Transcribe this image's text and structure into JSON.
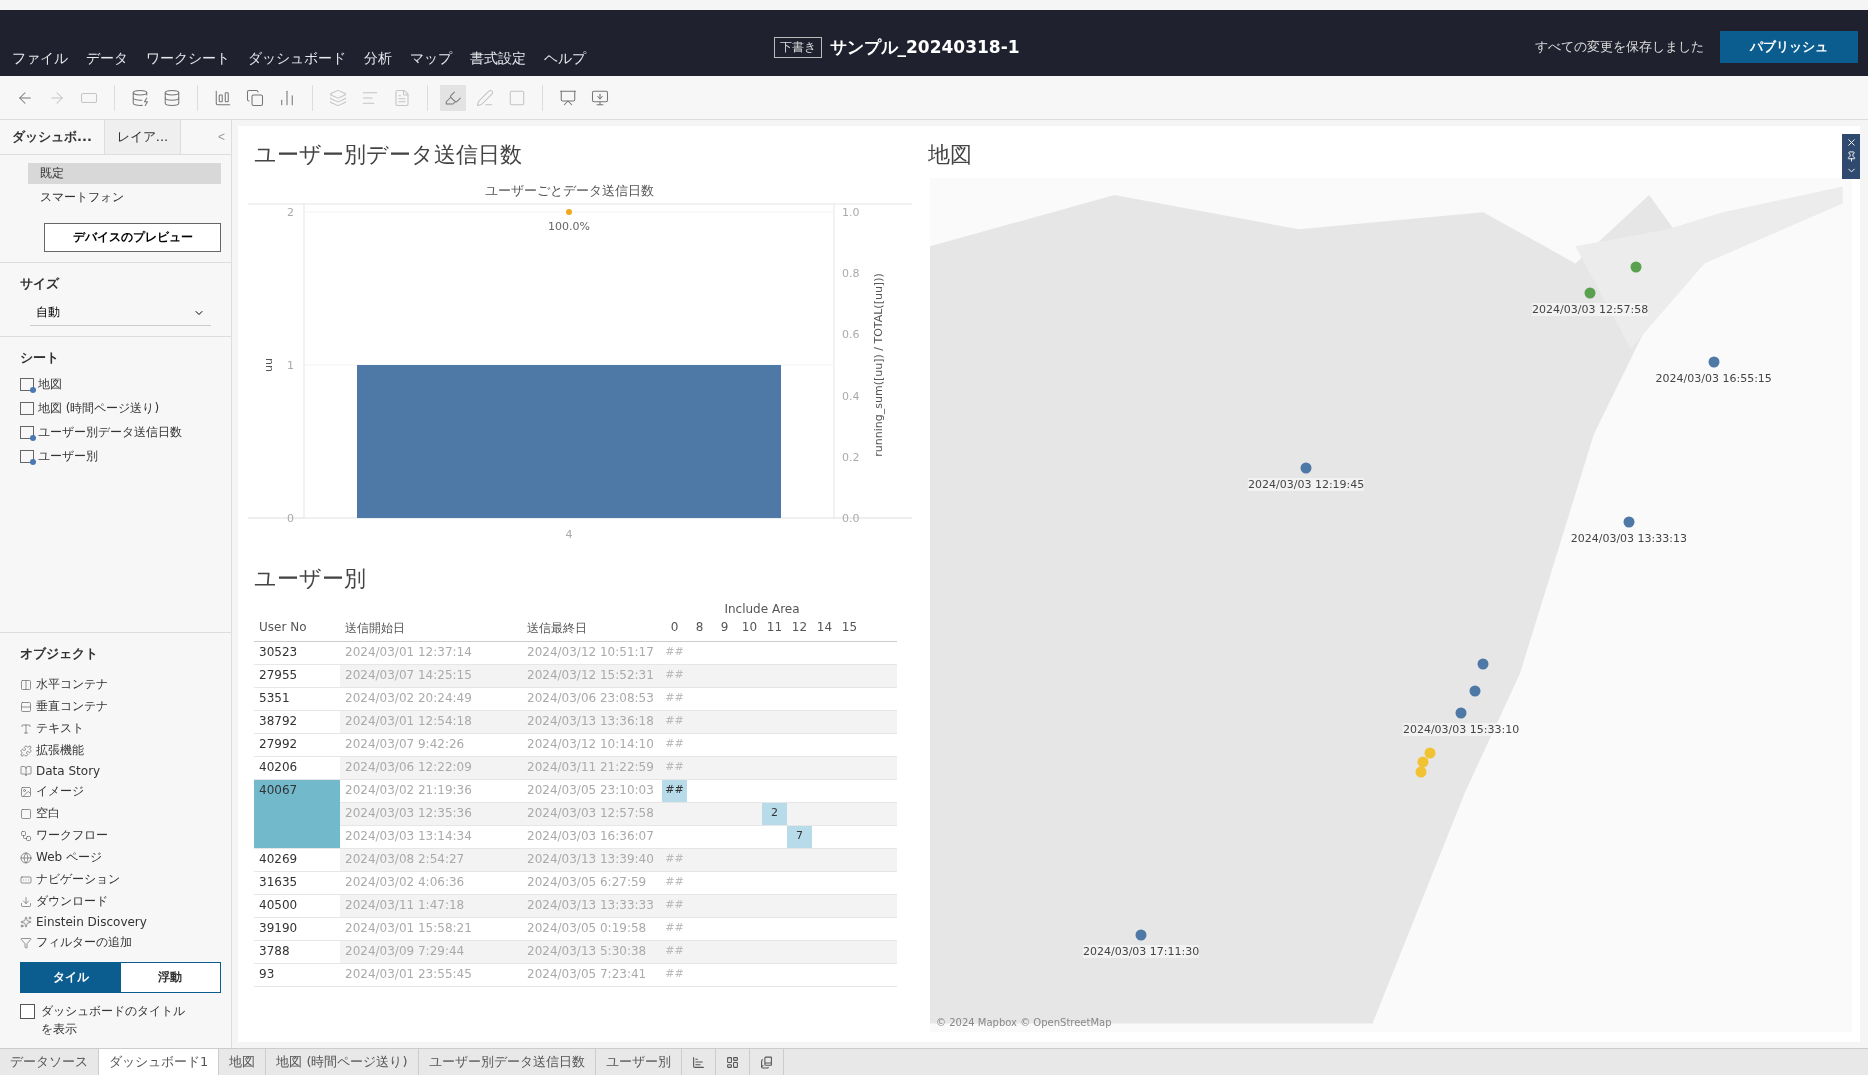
{
  "header": {
    "menus": [
      "ファイル",
      "データ",
      "ワークシート",
      "ダッシュボード",
      "分析",
      "マップ",
      "書式設定",
      "ヘルプ"
    ],
    "badge": "下書き",
    "title": "サンプル_20240318-1",
    "save_status": "すべての変更を保存しました",
    "publish": "パブリッシュ"
  },
  "sidebar": {
    "tabs": [
      {
        "label": "ダッシュボ...",
        "selected": true
      },
      {
        "label": "レイア...",
        "selected": false
      }
    ],
    "collapse": "<",
    "devices": [
      {
        "label": "既定",
        "selected": true
      },
      {
        "label": "スマートフォン",
        "selected": false
      }
    ],
    "preview_button": "デバイスのプレビュー",
    "size_heading": "サイズ",
    "size_value": "自動",
    "sheets_heading": "シート",
    "sheets": [
      "地図",
      "地図 (時間ページ送り)",
      "ユーザー別データ送信日数",
      "ユーザー別"
    ],
    "objects_heading": "オブジェクト",
    "objects": [
      "水平コンテナ",
      "垂直コンテナ",
      "テキスト",
      "拡張機能",
      "Data Story",
      "イメージ",
      "空白",
      "ワークフロー",
      "Web ページ",
      "ナビゲーション",
      "ダウンロード",
      "Einstein Discovery",
      "フィルターの追加"
    ],
    "layout_modes": [
      {
        "label": "タイル",
        "selected": true
      },
      {
        "label": "浮動",
        "selected": false
      }
    ],
    "show_title": {
      "label": "ダッシュボードのタイトルを表示",
      "checked": false
    }
  },
  "chart_panel": {
    "title": "ユーザー別データ送信日数",
    "point_label": "100.0%",
    "secondary_label": "running_sum([uu]) / TOTAL([uu]))",
    "secondary_ticks": [
      "1.0",
      "0.8",
      "0.6",
      "0.4",
      "0.2",
      "0.0"
    ],
    "chart_data": {
      "type": "bar",
      "title": "ユーザーごとデータ送信日数",
      "ylabel": "uu",
      "categories": [
        "4"
      ],
      "values": [
        1
      ],
      "ylim": [
        0,
        2
      ],
      "yticks": [
        0,
        1,
        2
      ]
    }
  },
  "table_panel": {
    "title": "ユーザー別",
    "group_header": "Include Area",
    "columns": [
      "User No",
      "送信開始日",
      "送信最終日"
    ],
    "area_columns": [
      "0",
      "8",
      "9",
      "10",
      "11",
      "12",
      "14",
      "15"
    ],
    "rows": [
      {
        "user": "30523",
        "selected": false,
        "entries": [
          {
            "start": "2024/03/01 12:37:14",
            "end": "2024/03/12 10:51:17",
            "selected": false,
            "area": [
              {
                "kind": "mark",
                "text": "##"
              }
            ]
          }
        ]
      },
      {
        "user": "27955",
        "selected": false,
        "entries": [
          {
            "start": "2024/03/07 14:25:15",
            "end": "2024/03/12 15:52:31",
            "selected": false,
            "area": [
              {
                "kind": "mark",
                "text": "##"
              }
            ]
          }
        ]
      },
      {
        "user": "5351",
        "selected": false,
        "entries": [
          {
            "start": "2024/03/02 20:24:49",
            "end": "2024/03/06 23:08:53",
            "selected": false,
            "area": [
              {
                "kind": "mark",
                "text": "##"
              }
            ]
          }
        ]
      },
      {
        "user": "38792",
        "selected": false,
        "entries": [
          {
            "start": "2024/03/01 12:54:18",
            "end": "2024/03/13 13:36:18",
            "selected": false,
            "area": [
              {
                "kind": "mark",
                "text": "##"
              }
            ]
          }
        ]
      },
      {
        "user": "27992",
        "selected": false,
        "entries": [
          {
            "start": "2024/03/07 9:42:26",
            "end": "2024/03/12 10:14:10",
            "selected": false,
            "area": [
              {
                "kind": "mark",
                "text": "##"
              }
            ]
          }
        ]
      },
      {
        "user": "40206",
        "selected": false,
        "entries": [
          {
            "start": "2024/03/06 12:22:09",
            "end": "2024/03/11 21:22:59",
            "selected": false,
            "area": [
              {
                "kind": "mark",
                "text": "##"
              }
            ]
          }
        ]
      },
      {
        "user": "40067",
        "selected": true,
        "entries": [
          {
            "start": "2024/03/02 21:19:36",
            "end": "2024/03/05 23:10:03",
            "selected": true,
            "area": [
              {
                "kind": "mark",
                "text": "##"
              }
            ]
          },
          {
            "start": "2024/03/03 12:35:36",
            "end": "2024/03/03 12:57:58",
            "selected": true,
            "area": [
              {
                "kind": "empty"
              },
              {
                "kind": "empty"
              },
              {
                "kind": "empty"
              },
              {
                "kind": "empty"
              },
              {
                "kind": "mark",
                "text": "2"
              }
            ]
          },
          {
            "start": "2024/03/03 13:14:34",
            "end": "2024/03/03 16:36:07",
            "selected": true,
            "area": [
              {
                "kind": "empty"
              },
              {
                "kind": "empty"
              },
              {
                "kind": "empty"
              },
              {
                "kind": "empty"
              },
              {
                "kind": "empty"
              },
              {
                "kind": "mark",
                "text": "7"
              }
            ]
          }
        ]
      },
      {
        "user": "40269",
        "selected": false,
        "entries": [
          {
            "start": "2024/03/08 2:54:27",
            "end": "2024/03/13 13:39:40",
            "selected": false,
            "area": [
              {
                "kind": "mark",
                "text": "##"
              }
            ]
          }
        ]
      },
      {
        "user": "31635",
        "selected": false,
        "entries": [
          {
            "start": "2024/03/02 4:06:36",
            "end": "2024/03/05 6:27:59",
            "selected": false,
            "area": [
              {
                "kind": "mark",
                "text": "##"
              }
            ]
          }
        ]
      },
      {
        "user": "40500",
        "selected": false,
        "entries": [
          {
            "start": "2024/03/11 1:47:18",
            "end": "2024/03/13 13:33:33",
            "selected": false,
            "area": [
              {
                "kind": "mark",
                "text": "##"
              }
            ]
          }
        ]
      },
      {
        "user": "39190",
        "selected": false,
        "entries": [
          {
            "start": "2024/03/01 15:58:21",
            "end": "2024/03/05 0:19:58",
            "selected": false,
            "area": [
              {
                "kind": "mark",
                "text": "##"
              }
            ]
          }
        ]
      },
      {
        "user": "3788",
        "selected": false,
        "entries": [
          {
            "start": "2024/03/09 7:29:44",
            "end": "2024/03/13 5:30:38",
            "selected": false,
            "area": [
              {
                "kind": "mark",
                "text": "##"
              }
            ]
          }
        ]
      },
      {
        "user": "93",
        "selected": false,
        "entries": [
          {
            "start": "2024/03/01 23:55:45",
            "end": "2024/03/05 7:23:41",
            "selected": false,
            "area": [
              {
                "kind": "mark",
                "text": "##"
              }
            ]
          }
        ]
      }
    ]
  },
  "map_panel": {
    "title": "地図",
    "attribution": "© 2024 Mapbox © OpenStreetMap",
    "markers": [
      {
        "color": "#59a14f"
      },
      {
        "color": "#59a14f",
        "label": "2024/03/03 12:57:58"
      },
      {
        "color": "#4e79a7",
        "label": "2024/03/03 16:55:15"
      },
      {
        "color": "#4e79a7",
        "label": "2024/03/03 12:19:45"
      },
      {
        "color": "#4e79a7",
        "label": "2024/03/03 13:33:13"
      },
      {
        "color": "#4e79a7"
      },
      {
        "color": "#4e79a7"
      },
      {
        "color": "#4e79a7",
        "label": "2024/03/03 15:33:10"
      },
      {
        "color": "#f1c232"
      },
      {
        "color": "#f1c232"
      },
      {
        "color": "#f1c232"
      },
      {
        "color": "#4e79a7",
        "label": "2024/03/03 17:11:30"
      }
    ]
  },
  "bottom_tabs": [
    {
      "label": "データソース",
      "selected": false
    },
    {
      "label": "ダッシュボード1",
      "selected": true
    },
    {
      "label": "地図",
      "selected": false
    },
    {
      "label": "地図 (時間ページ送り)",
      "selected": false
    },
    {
      "label": "ユーザー別データ送信日数",
      "selected": false
    },
    {
      "label": "ユーザー別",
      "selected": false
    }
  ]
}
